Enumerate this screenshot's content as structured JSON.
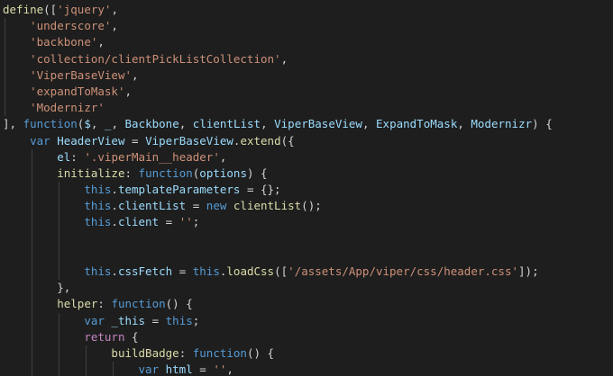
{
  "editor": {
    "theme_colors": {
      "background": "#1e1e1e",
      "default": "#d4d4d4",
      "keyword": "#569cd6",
      "control": "#c586c0",
      "function": "#dcdcaa",
      "variable": "#9cdcfe",
      "string": "#ce9178",
      "class": "#4ec9b0",
      "indent_guide": "#404040"
    },
    "lines": [
      {
        "indent": 0,
        "tokens": [
          {
            "t": "define",
            "c": "function"
          },
          {
            "t": "([",
            "c": "default"
          },
          {
            "t": "'jquery'",
            "c": "string"
          },
          {
            "t": ",",
            "c": "default"
          }
        ]
      },
      {
        "indent": 4,
        "tokens": [
          {
            "t": "'underscore'",
            "c": "string"
          },
          {
            "t": ",",
            "c": "default"
          }
        ]
      },
      {
        "indent": 4,
        "tokens": [
          {
            "t": "'backbone'",
            "c": "string"
          },
          {
            "t": ",",
            "c": "default"
          }
        ]
      },
      {
        "indent": 4,
        "tokens": [
          {
            "t": "'collection/clientPickListCollection'",
            "c": "string"
          },
          {
            "t": ",",
            "c": "default"
          }
        ]
      },
      {
        "indent": 4,
        "tokens": [
          {
            "t": "'ViperBaseView'",
            "c": "string"
          },
          {
            "t": ",",
            "c": "default"
          }
        ]
      },
      {
        "indent": 4,
        "tokens": [
          {
            "t": "'expandToMask'",
            "c": "string"
          },
          {
            "t": ",",
            "c": "default"
          }
        ]
      },
      {
        "indent": 4,
        "tokens": [
          {
            "t": "'Modernizr'",
            "c": "string"
          }
        ]
      },
      {
        "indent": 0,
        "tokens": [
          {
            "t": "], ",
            "c": "default"
          },
          {
            "t": "function",
            "c": "keyword"
          },
          {
            "t": "(",
            "c": "default"
          },
          {
            "t": "$",
            "c": "variable"
          },
          {
            "t": ", ",
            "c": "default"
          },
          {
            "t": "_",
            "c": "variable"
          },
          {
            "t": ", ",
            "c": "default"
          },
          {
            "t": "Backbone",
            "c": "variable"
          },
          {
            "t": ", ",
            "c": "default"
          },
          {
            "t": "clientList",
            "c": "variable"
          },
          {
            "t": ", ",
            "c": "default"
          },
          {
            "t": "ViperBaseView",
            "c": "variable"
          },
          {
            "t": ", ",
            "c": "default"
          },
          {
            "t": "ExpandToMask",
            "c": "variable"
          },
          {
            "t": ", ",
            "c": "default"
          },
          {
            "t": "Modernizr",
            "c": "variable"
          },
          {
            "t": ") {",
            "c": "default"
          }
        ]
      },
      {
        "indent": 4,
        "tokens": [
          {
            "t": "var",
            "c": "keyword"
          },
          {
            "t": " ",
            "c": "default"
          },
          {
            "t": "HeaderView",
            "c": "variable"
          },
          {
            "t": " = ",
            "c": "default"
          },
          {
            "t": "ViperBaseView",
            "c": "variable"
          },
          {
            "t": ".",
            "c": "default"
          },
          {
            "t": "extend",
            "c": "function"
          },
          {
            "t": "({",
            "c": "default"
          }
        ]
      },
      {
        "indent": 8,
        "tokens": [
          {
            "t": "el",
            "c": "variable"
          },
          {
            "t": ": ",
            "c": "default"
          },
          {
            "t": "'.viperMain__header'",
            "c": "string"
          },
          {
            "t": ",",
            "c": "default"
          }
        ]
      },
      {
        "indent": 8,
        "tokens": [
          {
            "t": "initialize",
            "c": "function"
          },
          {
            "t": ": ",
            "c": "default"
          },
          {
            "t": "function",
            "c": "keyword"
          },
          {
            "t": "(",
            "c": "default"
          },
          {
            "t": "options",
            "c": "variable"
          },
          {
            "t": ") {",
            "c": "default"
          }
        ]
      },
      {
        "indent": 12,
        "tokens": [
          {
            "t": "this",
            "c": "keyword"
          },
          {
            "t": ".",
            "c": "default"
          },
          {
            "t": "templateParameters",
            "c": "variable"
          },
          {
            "t": " = {};",
            "c": "default"
          }
        ]
      },
      {
        "indent": 12,
        "tokens": [
          {
            "t": "this",
            "c": "keyword"
          },
          {
            "t": ".",
            "c": "default"
          },
          {
            "t": "clientList",
            "c": "variable"
          },
          {
            "t": " = ",
            "c": "default"
          },
          {
            "t": "new",
            "c": "keyword"
          },
          {
            "t": " ",
            "c": "default"
          },
          {
            "t": "clientList",
            "c": "function"
          },
          {
            "t": "();",
            "c": "default"
          }
        ]
      },
      {
        "indent": 12,
        "tokens": [
          {
            "t": "this",
            "c": "keyword"
          },
          {
            "t": ".",
            "c": "default"
          },
          {
            "t": "client",
            "c": "variable"
          },
          {
            "t": " = ",
            "c": "default"
          },
          {
            "t": "''",
            "c": "string"
          },
          {
            "t": ";",
            "c": "default"
          }
        ]
      },
      {
        "indent": 0,
        "tokens": []
      },
      {
        "indent": 0,
        "tokens": []
      },
      {
        "indent": 12,
        "tokens": [
          {
            "t": "this",
            "c": "keyword"
          },
          {
            "t": ".",
            "c": "default"
          },
          {
            "t": "cssFetch",
            "c": "variable"
          },
          {
            "t": " = ",
            "c": "default"
          },
          {
            "t": "this",
            "c": "keyword"
          },
          {
            "t": ".",
            "c": "default"
          },
          {
            "t": "loadCss",
            "c": "function"
          },
          {
            "t": "([",
            "c": "default"
          },
          {
            "t": "'/assets/App/viper/css/header.css'",
            "c": "string"
          },
          {
            "t": "]);",
            "c": "default"
          }
        ]
      },
      {
        "indent": 8,
        "tokens": [
          {
            "t": "},",
            "c": "default"
          }
        ]
      },
      {
        "indent": 8,
        "tokens": [
          {
            "t": "helper",
            "c": "function"
          },
          {
            "t": ": ",
            "c": "default"
          },
          {
            "t": "function",
            "c": "keyword"
          },
          {
            "t": "() {",
            "c": "default"
          }
        ]
      },
      {
        "indent": 12,
        "tokens": [
          {
            "t": "var",
            "c": "keyword"
          },
          {
            "t": " ",
            "c": "default"
          },
          {
            "t": "_this",
            "c": "variable"
          },
          {
            "t": " = ",
            "c": "default"
          },
          {
            "t": "this",
            "c": "keyword"
          },
          {
            "t": ";",
            "c": "default"
          }
        ]
      },
      {
        "indent": 12,
        "tokens": [
          {
            "t": "return",
            "c": "control"
          },
          {
            "t": " {",
            "c": "default"
          }
        ]
      },
      {
        "indent": 16,
        "tokens": [
          {
            "t": "buildBadge",
            "c": "function"
          },
          {
            "t": ": ",
            "c": "default"
          },
          {
            "t": "function",
            "c": "keyword"
          },
          {
            "t": "() {",
            "c": "default"
          }
        ]
      },
      {
        "indent": 20,
        "tokens": [
          {
            "t": "var",
            "c": "keyword"
          },
          {
            "t": " ",
            "c": "default"
          },
          {
            "t": "html",
            "c": "variable"
          },
          {
            "t": " = ",
            "c": "default"
          },
          {
            "t": "''",
            "c": "string"
          },
          {
            "t": ",",
            "c": "default"
          }
        ]
      }
    ],
    "guides": [
      {
        "col": 0,
        "from": 1,
        "to": 6
      },
      {
        "col": 4,
        "from": 9,
        "to": 22
      },
      {
        "col": 8,
        "from": 11,
        "to": 16
      },
      {
        "col": 8,
        "from": 19,
        "to": 22
      },
      {
        "col": 12,
        "from": 21,
        "to": 22
      },
      {
        "col": 16,
        "from": 22,
        "to": 22
      }
    ]
  }
}
